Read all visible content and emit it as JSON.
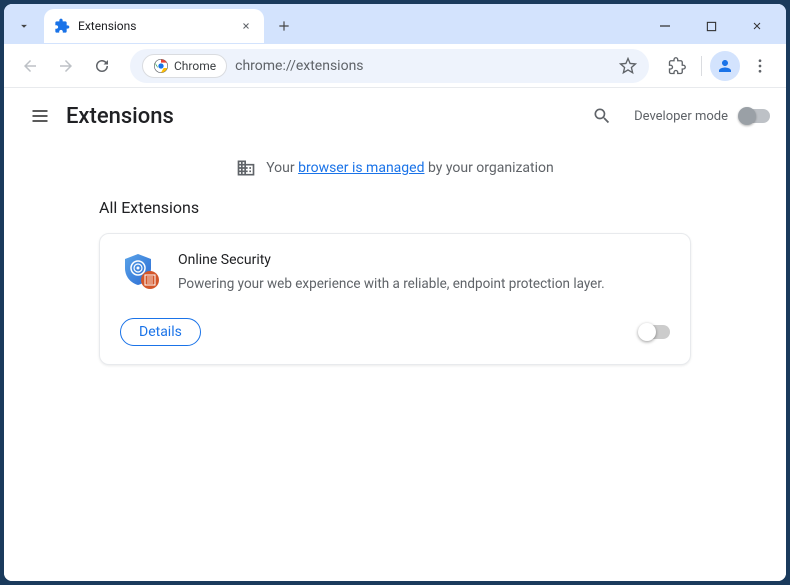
{
  "tab": {
    "title": "Extensions"
  },
  "omnibox": {
    "chip_label": "Chrome",
    "url": "chrome://extensions"
  },
  "page": {
    "title": "Extensions",
    "dev_mode_label": "Developer mode"
  },
  "managed_banner": {
    "prefix": "Your ",
    "link_text": "browser is managed",
    "suffix": " by your organization"
  },
  "section": {
    "title": "All Extensions"
  },
  "extension": {
    "name": "Online Security",
    "description": "Powering your web experience with a reliable, endpoint protection layer.",
    "details_label": "Details"
  }
}
